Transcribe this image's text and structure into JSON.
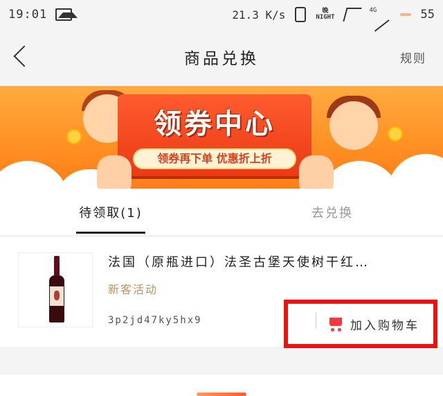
{
  "status_bar": {
    "time": "19:01",
    "speed": "21.3",
    "speed_unit": "K/s",
    "network": "4G",
    "battery": "55"
  },
  "header": {
    "title": "商品兑换",
    "rules_label": "规则"
  },
  "banner": {
    "headline": "领券中心",
    "subline": "领券再下单 优惠折上折"
  },
  "tabs": [
    {
      "label": "待领取(1)",
      "active": true
    },
    {
      "label": "去兑换",
      "active": false
    }
  ],
  "product": {
    "name": "法国（原瓶进口）法圣古堡天使树干红…",
    "tag": "新客活动",
    "code": "3p2jd47ky5hx9",
    "add_to_cart_label": "加入购物车"
  },
  "colors": {
    "accent_red": "#ee1111",
    "tag_brown": "#c8905a",
    "banner_orange": "#ff8f22"
  }
}
